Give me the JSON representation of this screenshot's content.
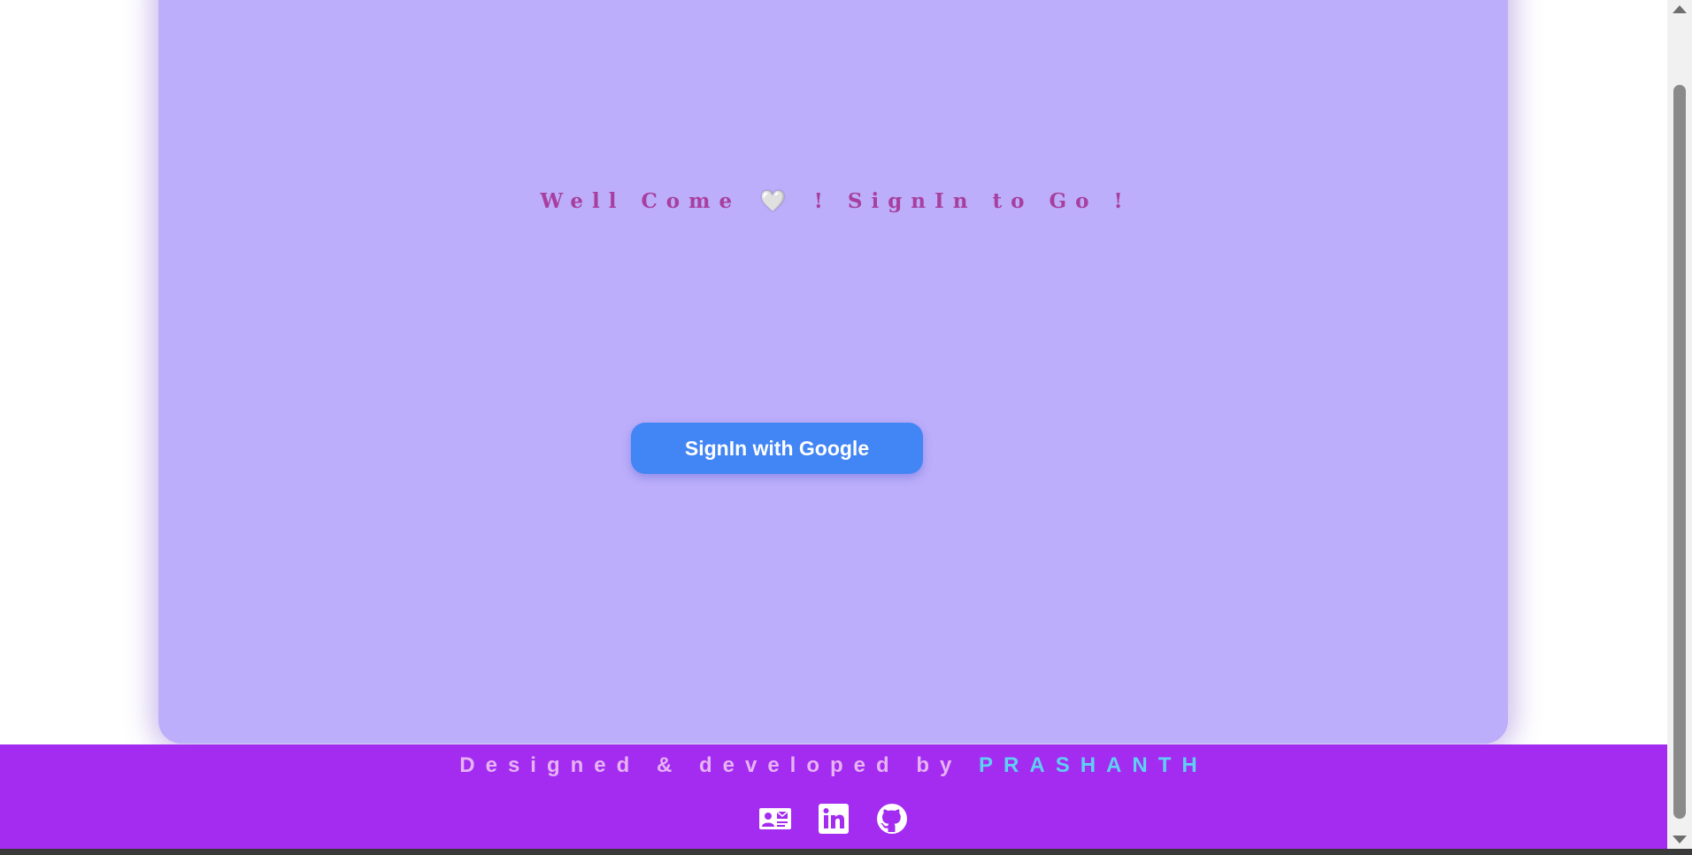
{
  "welcome": {
    "text_before": "Well Come",
    "heart": "🤍",
    "text_after": "! SignIn to Go !"
  },
  "signin": {
    "label": "SignIn with Google"
  },
  "footer": {
    "credit_prefix": "Designed & developed by",
    "author": "PRASHANTH",
    "links": [
      {
        "icon": "contact-card-icon"
      },
      {
        "icon": "linkedin-icon"
      },
      {
        "icon": "github-icon"
      }
    ]
  },
  "colors": {
    "card_background": "#bcaefa",
    "welcome_text": "#a83fa0",
    "button_background": "#4285f4",
    "footer_background": "#a32cf0",
    "footer_text": "#e7b3f3",
    "author_text": "#5fd0f4"
  }
}
